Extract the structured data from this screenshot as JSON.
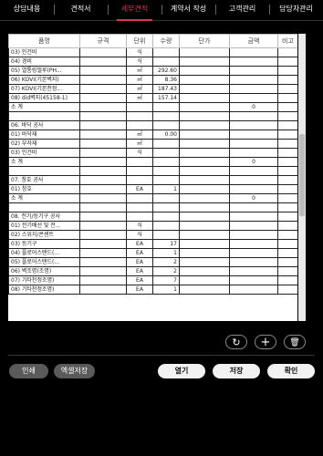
{
  "tabs": [
    {
      "label": "상담내용"
    },
    {
      "label": "견적서"
    },
    {
      "label": "세부견적"
    },
    {
      "label": "계약서 작성"
    },
    {
      "label": "고객관리"
    },
    {
      "label": "담당자관리"
    }
  ],
  "grid": {
    "headers": [
      "품명",
      "규격",
      "단위",
      "수량",
      "단가",
      "금액",
      "비고"
    ],
    "rows": [
      [
        "03) 인건비",
        "",
        "식",
        "",
        "",
        "",
        ""
      ],
      [
        "04) 경비",
        "",
        "식",
        "",
        "",
        "",
        ""
      ],
      [
        "05) 열통링멀루(PH...",
        "",
        "㎡",
        "292.60",
        "",
        "",
        ""
      ],
      [
        "06) KOVI(기본벽지)",
        "",
        "㎡",
        "8.36",
        "",
        "",
        ""
      ],
      [
        "07) KOVI(기본천정...",
        "",
        "㎡",
        "187.43",
        "",
        "",
        ""
      ],
      [
        "08) did벽지(45158-1)",
        "",
        "㎡",
        "157.14",
        "",
        "",
        ""
      ],
      [
        "소  계",
        "",
        "",
        "",
        "",
        "0",
        ""
      ],
      [
        "",
        "",
        "",
        "",
        "",
        "",
        ""
      ],
      [
        "06. 바닥 공사",
        "",
        "",
        "",
        "",
        "",
        ""
      ],
      [
        "01) 바닥재",
        "",
        "㎡",
        "0.00",
        "",
        "",
        ""
      ],
      [
        "02) 부자재",
        "",
        "㎡",
        "",
        "",
        "",
        ""
      ],
      [
        "03) 인건비",
        "",
        "식",
        "",
        "",
        "",
        ""
      ],
      [
        "소  계",
        "",
        "",
        "",
        "",
        "0",
        ""
      ],
      [
        "",
        "",
        "",
        "",
        "",
        "",
        ""
      ],
      [
        "07. 창호 공사",
        "",
        "",
        "",
        "",
        "",
        ""
      ],
      [
        "01) 창호",
        "",
        "EA",
        "1",
        "",
        "",
        ""
      ],
      [
        "소  계",
        "",
        "",
        "",
        "",
        "0",
        ""
      ],
      [
        "",
        "",
        "",
        "",
        "",
        "",
        ""
      ],
      [
        "08. 전기/등기구 공사",
        "",
        "",
        "",
        "",
        "",
        ""
      ],
      [
        "01) 전기배선 및 전...",
        "",
        "식",
        "",
        "",
        "",
        ""
      ],
      [
        "02) 스위치/콘센트",
        "",
        "식",
        "",
        "",
        "",
        ""
      ],
      [
        "03) 등기구",
        "",
        "EA",
        "17",
        "",
        "",
        ""
      ],
      [
        "04) 플로어스탠드(...",
        "",
        "EA",
        "1",
        "",
        "",
        ""
      ],
      [
        "05) 플로어스탠드(...",
        "",
        "EA",
        "2",
        "",
        "",
        ""
      ],
      [
        "06) 벽조명(조명)",
        "",
        "EA",
        "2",
        "",
        "",
        ""
      ],
      [
        "07) 기타천정조명)",
        "",
        "EA",
        "7",
        "",
        "",
        ""
      ],
      [
        "08) 기타천정조명)",
        "",
        "EA",
        "1",
        "",
        "",
        ""
      ]
    ]
  },
  "icons": {
    "reset": "↻",
    "add": "+",
    "delete": "🗑"
  },
  "buttons": {
    "print": "인쇄",
    "excel": "엑셀저장",
    "open": "열기",
    "save": "저장",
    "confirm": "확인"
  }
}
